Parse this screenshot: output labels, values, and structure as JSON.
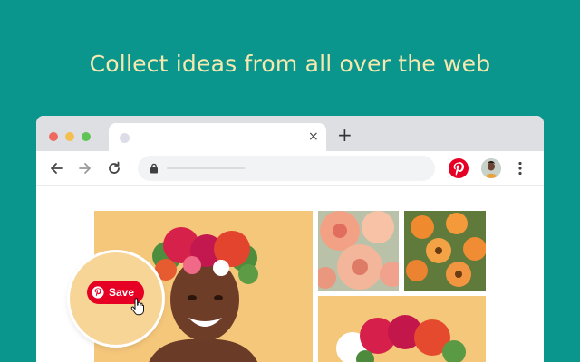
{
  "headline": "Collect ideas from all over the web",
  "browser": {
    "tab": {
      "close_glyph": "×"
    },
    "new_tab_glyph": "+",
    "toolbar": {
      "back_icon": "arrow-left-icon",
      "forward_icon": "arrow-right-icon",
      "reload_icon": "reload-icon",
      "lock_icon": "lock-icon",
      "extension_icon": "pinterest-logo-icon",
      "profile": "avatar",
      "menu_icon": "kebab-menu-icon"
    }
  },
  "save_button": {
    "label": "Save"
  },
  "colors": {
    "background": "#0a968c",
    "headline": "#f7e8b0",
    "pinterest_red": "#e60023",
    "photo_backdrop": "#f5c77b"
  }
}
